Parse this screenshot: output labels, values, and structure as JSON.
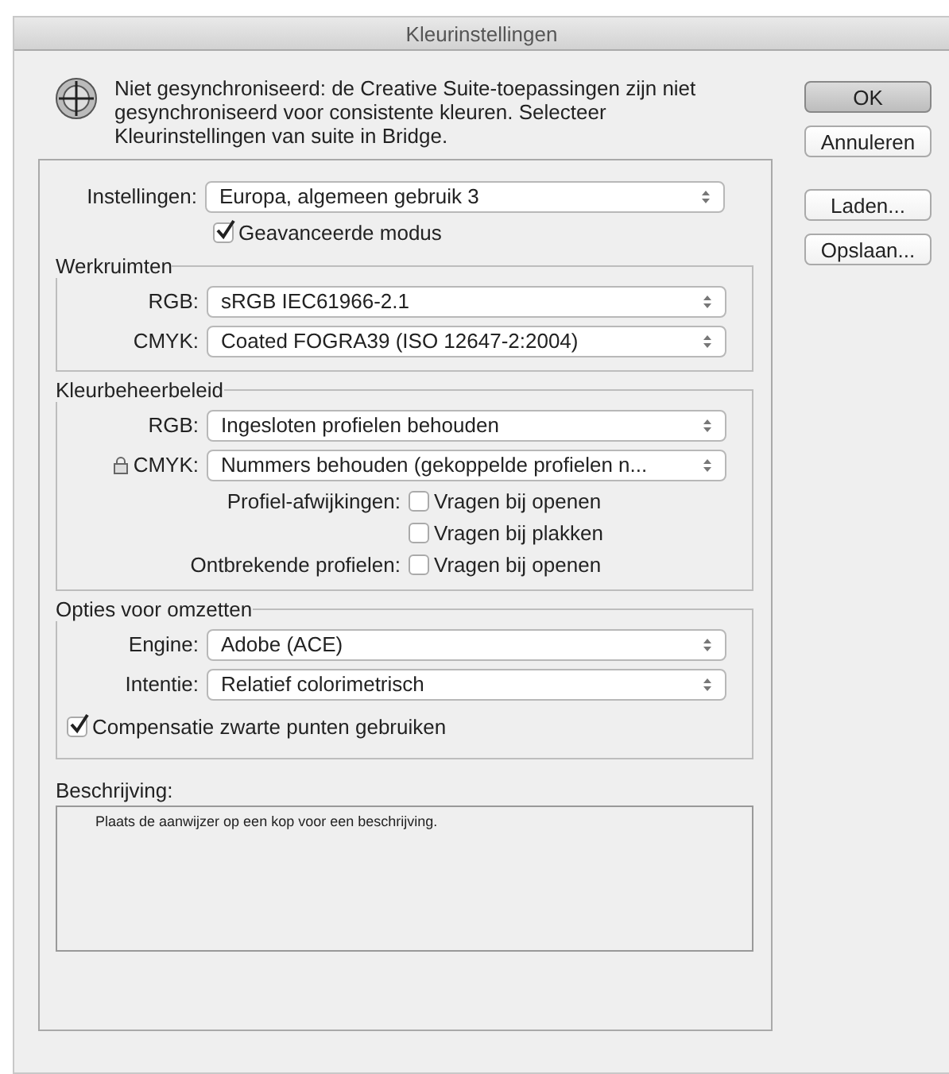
{
  "window": {
    "title": "Kleurinstellingen"
  },
  "message": "Niet gesynchroniseerd: de Creative Suite-toepassingen zijn niet gesynchroniseerd voor consistente kleuren. Selecteer Kleurinstellingen van suite in Bridge.",
  "buttons": [
    {
      "label": "OK",
      "default": true
    },
    {
      "label": "Annuleren",
      "default": false
    },
    {
      "label": "Laden...",
      "default": false
    },
    {
      "label": "Opslaan...",
      "default": false
    }
  ],
  "settings": {
    "label": "Instellingen:",
    "value": "Europa, algemeen gebruik 3"
  },
  "advanced_mode": {
    "label": "Geavanceerde modus",
    "checked": true
  },
  "sections": [
    {
      "title": "Werkruimten",
      "rows": [
        {
          "kind": "select",
          "label": "RGB:",
          "value": "sRGB IEC61966-2.1",
          "locked": false
        },
        {
          "kind": "select",
          "label": "CMYK:",
          "value": "Coated FOGRA39 (ISO 12647-2:2004)",
          "locked": false
        }
      ]
    },
    {
      "title": "Kleurbeheerbeleid",
      "rows": [
        {
          "kind": "select",
          "label": "RGB:",
          "value": "Ingesloten profielen behouden",
          "locked": false
        },
        {
          "kind": "select",
          "label": "CMYK:",
          "value": "Nummers behouden (gekoppelde profielen n...",
          "locked": true
        },
        {
          "kind": "check",
          "label": "Profiel-afwijkingen:",
          "option": "Vragen bij openen",
          "checked": false
        },
        {
          "kind": "check",
          "option": "Vragen bij plakken",
          "checked": false
        },
        {
          "kind": "check",
          "label": "Ontbrekende profielen:",
          "option": "Vragen bij openen",
          "checked": false
        }
      ]
    },
    {
      "title": "Opties voor omzetten",
      "rows": [
        {
          "kind": "select",
          "label": "Engine:",
          "value": "Adobe (ACE)",
          "locked": false
        },
        {
          "kind": "select",
          "label": "Intentie:",
          "value": "Relatief colorimetrisch",
          "locked": false
        },
        {
          "kind": "plaincheck",
          "option": "Compensatie zwarte punten gebruiken",
          "checked": true
        }
      ]
    }
  ],
  "description": {
    "label": "Beschrijving:",
    "text": "Plaats de aanwijzer op een kop voor een beschrijving."
  }
}
